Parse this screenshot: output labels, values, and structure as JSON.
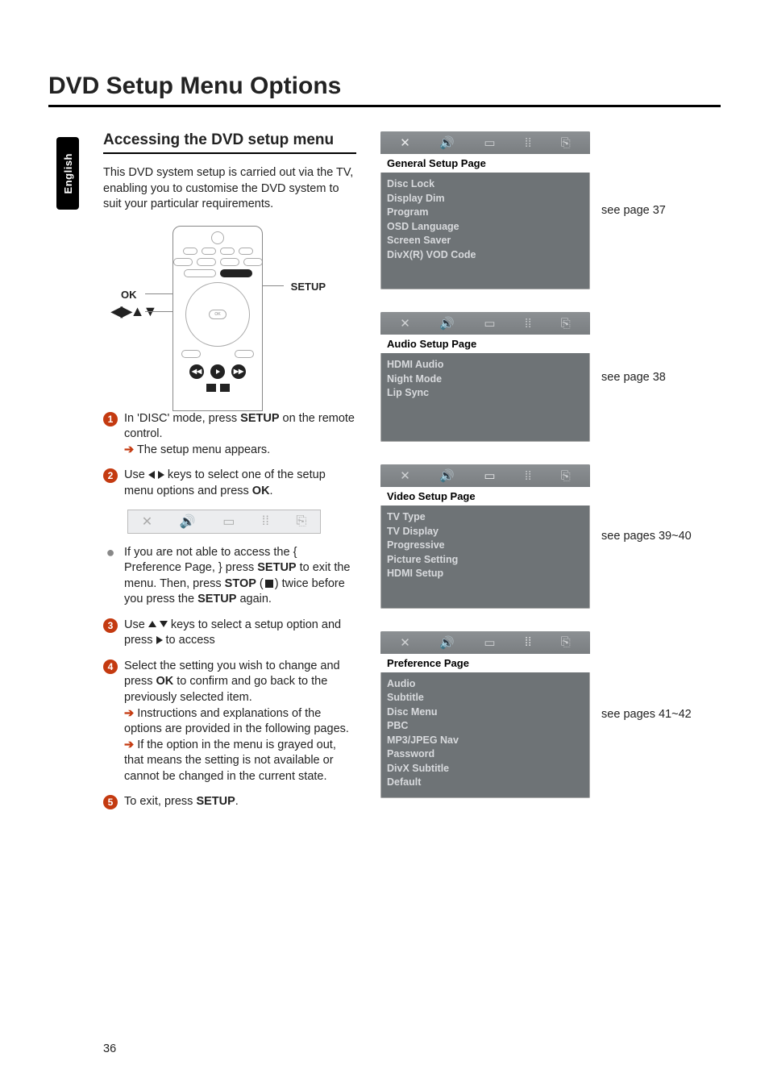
{
  "page_number": "36",
  "language_tab": "English",
  "main_title": "DVD Setup Menu Options",
  "section_title": "Accessing the DVD setup menu",
  "intro": "This DVD system setup is carried out via the TV, enabling you to customise the DVD system to suit your particular requirements.",
  "remote": {
    "label_ok": "OK",
    "label_arrows": "◀▶▲▼",
    "label_setup": "SETUP"
  },
  "steps": {
    "s1_a": "In 'DISC' mode, press ",
    "s1_b": "SETUP",
    "s1_c": " on the remote control.",
    "s1_sub": "The setup menu appears.",
    "s2_a": "Use ",
    "s2_b": " keys to select one of the setup menu options and press ",
    "s2_c": "OK",
    "s2_d": ".",
    "bullet_a": "If you are not able to access the { Preference Page, } press ",
    "bullet_b": "SETUP",
    "bullet_c": " to exit the menu.  Then, press ",
    "bullet_d": "STOP",
    "bullet_e": " twice before you press the ",
    "bullet_f": "SETUP",
    "bullet_g": " again.",
    "s3_a": "Use ",
    "s3_b": " keys to select a setup option and press ",
    "s3_c": " to access",
    "s4_a": "Select the setting you wish to change and press ",
    "s4_b": "OK",
    "s4_c": " to confirm and go back to the previously selected item.",
    "s4_sub1": "Instructions and explanations of the options are provided in the following pages.",
    "s4_sub2": "If the option in the menu is grayed out, that means the setting is not available or cannot be changed in the current state.",
    "s5_a": "To exit, press ",
    "s5_b": "SETUP",
    "s5_c": "."
  },
  "panels": [
    {
      "title": "General Setup Page",
      "items": [
        "Disc Lock",
        "Display Dim",
        "Program",
        "OSD Language",
        "Screen Saver",
        "DivX(R) VOD Code"
      ],
      "ref": "see page 37"
    },
    {
      "title": "Audio Setup Page",
      "items": [
        "HDMI Audio",
        "Night Mode",
        "Lip Sync"
      ],
      "ref": "see page 38"
    },
    {
      "title": "Video Setup Page",
      "items": [
        "TV Type",
        "TV Display",
        "Progressive",
        "Picture Setting",
        "HDMI Setup"
      ],
      "ref": "see pages 39~40"
    },
    {
      "title": "Preference Page",
      "items": [
        "Audio",
        "Subtitle",
        "Disc Menu",
        "PBC",
        "MP3/JPEG Nav",
        "Password",
        "DivX Subtitle",
        "Default"
      ],
      "ref": "see pages 41~42"
    }
  ]
}
